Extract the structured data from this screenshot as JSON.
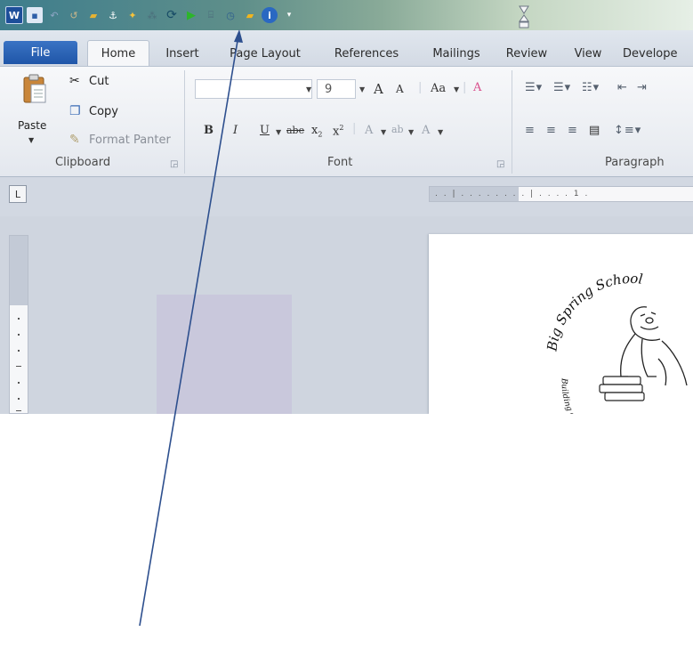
{
  "quick_access": {
    "items": [
      {
        "icon": "word-logo-icon",
        "glyph": "W"
      },
      {
        "icon": "save-icon",
        "glyph": "▪"
      },
      {
        "icon": "undo-icon",
        "glyph": "↶"
      },
      {
        "icon": "redo-icon",
        "glyph": "↺"
      },
      {
        "icon": "folder-icon",
        "glyph": "▰"
      },
      {
        "icon": "anchor-icon",
        "glyph": "⚓"
      },
      {
        "icon": "tag-icon",
        "glyph": "✦"
      },
      {
        "icon": "grid-icon",
        "glyph": "⁂"
      },
      {
        "icon": "refresh-icon",
        "glyph": "⟳"
      },
      {
        "icon": "play-icon",
        "glyph": "▶"
      },
      {
        "icon": "bracket-icon",
        "glyph": "⌸"
      },
      {
        "icon": "clock-icon",
        "glyph": "◷"
      },
      {
        "icon": "open-folder-icon",
        "glyph": "▰"
      },
      {
        "icon": "info-icon",
        "glyph": "i"
      },
      {
        "icon": "customize-icon",
        "glyph": "▾"
      }
    ]
  },
  "tabs": {
    "file": "File",
    "items": [
      "Home",
      "Insert",
      "Page Layout",
      "References",
      "Mailings",
      "Review",
      "View",
      "Develope"
    ]
  },
  "clipboard": {
    "paste": "Paste",
    "cut": "Cut",
    "copy": "Copy",
    "format_painter": "Format Panter",
    "group": "Clipboard"
  },
  "font": {
    "font_name": "",
    "size": "9",
    "grow": "A",
    "shrink": "A",
    "change_case": "Aa",
    "clear": "A",
    "bold": "B",
    "italic": "I",
    "underline": "U",
    "strikethrough": "abe",
    "subscript": "x",
    "superscript": "x",
    "effects": "A",
    "highlight": "ab",
    "color": "A",
    "group": "Font"
  },
  "paragraph": {
    "group": "Paragraph"
  },
  "ruler": {
    "tab_selector": "L",
    "marks": ". . | . . . . . . . . | . . . . 1 ."
  },
  "colors": {
    "file_tab": "#2a62b6",
    "arrow": "#2d4f8e",
    "highlight": "#c9c8dc"
  }
}
